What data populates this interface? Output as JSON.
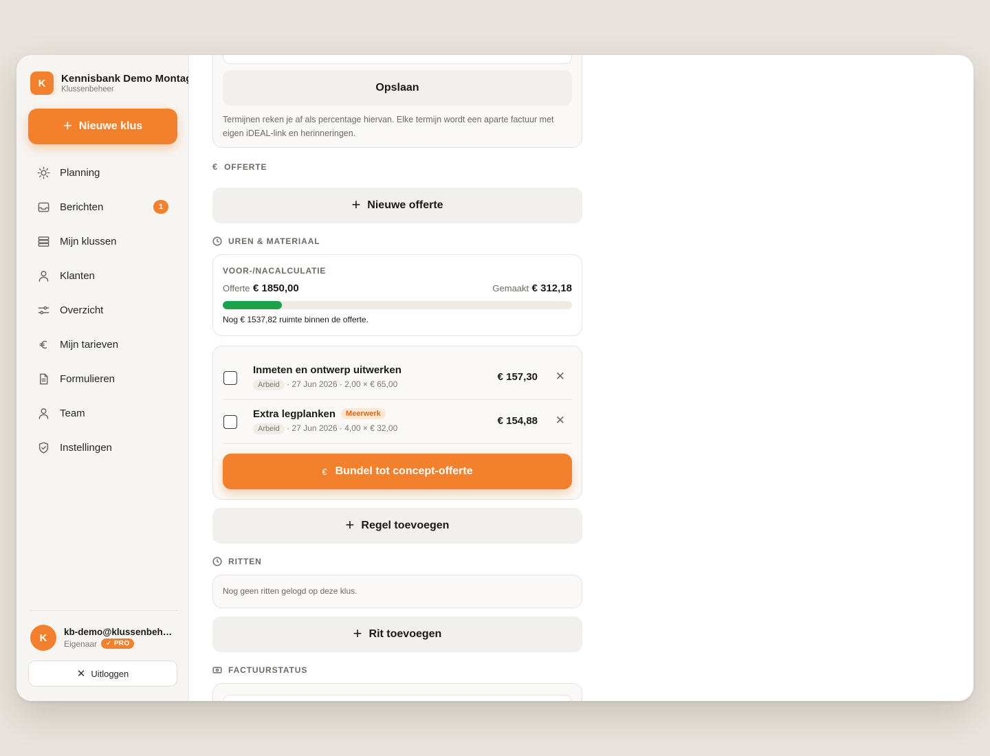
{
  "brand": {
    "initial": "K",
    "name": "Kennisbank Demo Montage",
    "subtitle": "Klussenbeheer"
  },
  "new_job": {
    "label": "Nieuwe klus"
  },
  "nav": [
    {
      "label": "Planning",
      "icon": "sun-icon"
    },
    {
      "label": "Berichten",
      "icon": "inbox-icon",
      "badge": "1"
    },
    {
      "label": "Mijn klussen",
      "icon": "stack-icon"
    },
    {
      "label": "Klanten",
      "icon": "user-icon"
    },
    {
      "label": "Overzicht",
      "icon": "sliders-icon"
    },
    {
      "label": "Mijn tarieven",
      "icon": "euro-icon"
    },
    {
      "label": "Formulieren",
      "icon": "document-icon"
    },
    {
      "label": "Team",
      "icon": "team-icon"
    },
    {
      "label": "Instellingen",
      "icon": "shield-icon"
    }
  ],
  "user": {
    "initial": "K",
    "email": "kb-demo@klussenbeheer.nl",
    "role": "Eigenaar",
    "plan": "PRO"
  },
  "logout": {
    "label": "Uitloggen"
  },
  "terms": {
    "save_label": "Opslaan",
    "note": "Termijnen reken je af als percentage hiervan. Elke termijn wordt een aparte factuur met eigen iDEAL-link en herinneringen."
  },
  "quote": {
    "section_title": "OFFERTE",
    "new_label": "Nieuwe offerte"
  },
  "hours": {
    "section_title": "UREN & MATERIAAL",
    "calc_title": "VOOR-/NACALCULATIE",
    "quote_label": "Offerte",
    "quote_value": "€ 1850,00",
    "made_label": "Gemaakt",
    "made_value": "€ 312,18",
    "progress": 0.169,
    "remaining_note": "Nog € 1537,82 ruimte binnen de offerte.",
    "lines": [
      {
        "title": "Inmeten en ontwerp uitwerken",
        "type": "Arbeid",
        "meta": "· 27 Jun 2026 · 2,00 × € 65,00",
        "amount": "€ 157,30",
        "tag": ""
      },
      {
        "title": "Extra legplanken",
        "type": "Arbeid",
        "meta": "· 27 Jun 2026 · 4,00 × € 32,00",
        "amount": "€ 154,88",
        "tag": "Meerwerk"
      }
    ],
    "bundle_label": "Bundel tot concept-offerte",
    "add_line_label": "Regel toevoegen"
  },
  "trips": {
    "section_title": "RITTEN",
    "empty": "Nog geen ritten gelogd op deze klus.",
    "add_label": "Rit toevoegen"
  },
  "invoice": {
    "section_title": "FACTUURSTATUS"
  },
  "colors": {
    "accent": "#f3802c",
    "progress": "#1aa34a",
    "background": "#e8e3dc"
  }
}
